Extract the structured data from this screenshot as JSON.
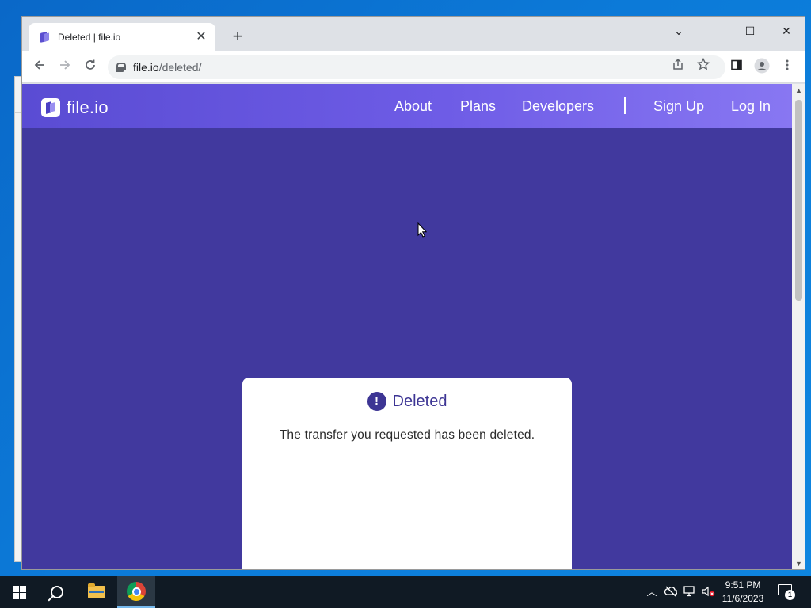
{
  "browser": {
    "tab_title": "Deleted | file.io",
    "tab_close": "✕",
    "new_tab": "+",
    "url_host": "file.io",
    "url_path": "/deleted/",
    "window_controls": {
      "menu": "⌄",
      "minimize": "—",
      "maximize": "☐",
      "close": "✕"
    },
    "toolbar_icons": [
      "back-icon",
      "forward-icon",
      "reload-icon",
      "share-icon",
      "star-icon",
      "side-panel-icon",
      "profile-icon",
      "menu-icon"
    ]
  },
  "site": {
    "logo_text": "file.io",
    "nav": {
      "about": "About",
      "plans": "Plans",
      "developers": "Developers",
      "sign_up": "Sign Up",
      "log_in": "Log In"
    },
    "card": {
      "icon": "!",
      "title": "Deleted",
      "message": "The transfer you requested has been deleted."
    }
  },
  "taskbar": {
    "time": "9:51 PM",
    "date": "11/6/2023",
    "notification_count": "1",
    "pinned": [
      "start-icon",
      "search-icon",
      "file-explorer-icon",
      "chrome-icon"
    ]
  },
  "colors": {
    "page_bg": "#41399e",
    "header_start": "#5a4cd3",
    "header_end": "#8877f2",
    "accent": "#3d3594"
  }
}
